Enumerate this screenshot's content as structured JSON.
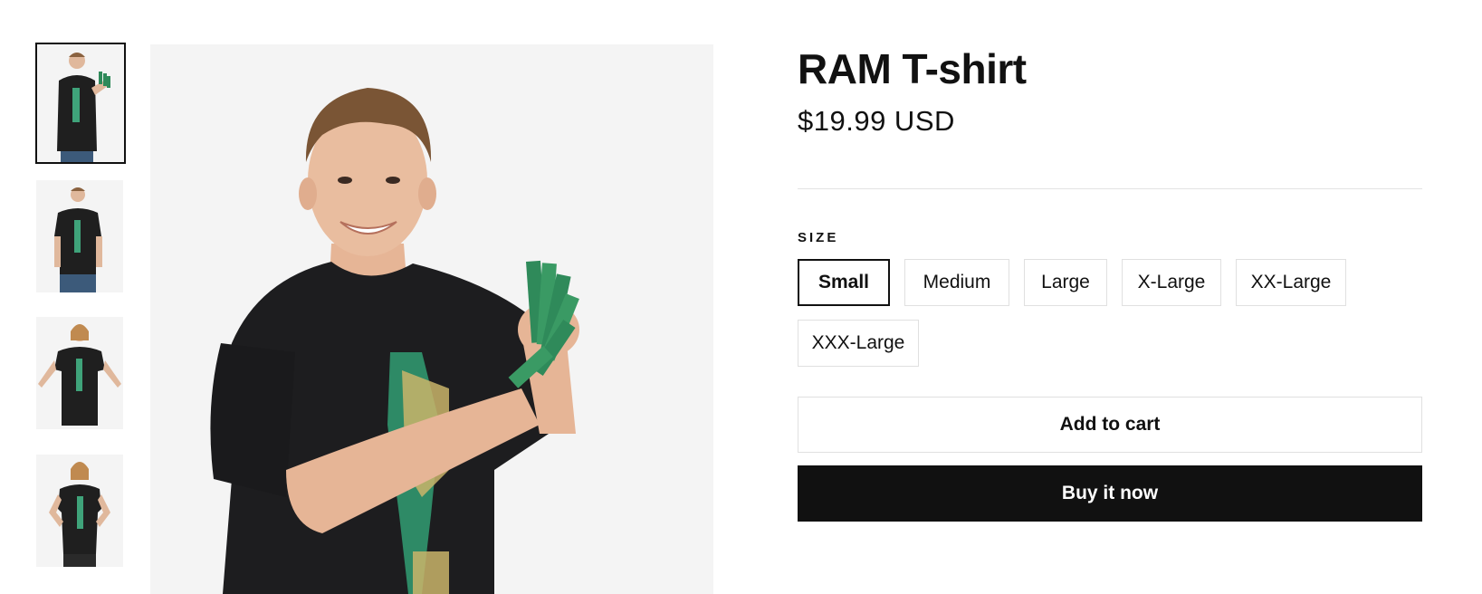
{
  "product": {
    "title": "RAM T-shirt",
    "price": "$19.99 USD"
  },
  "gallery": {
    "thumbnails": [
      {
        "name": "thumb-front-holding-ram",
        "active": true
      },
      {
        "name": "thumb-front-standing"
      },
      {
        "name": "thumb-arms-out"
      },
      {
        "name": "thumb-hands-on-hips"
      }
    ],
    "main_image": "man-in-black-ram-tshirt-holding-ram-sticks"
  },
  "options": {
    "size_label": "SIZE",
    "sizes": [
      "Small",
      "Medium",
      "Large",
      "X-Large",
      "XX-Large",
      "XXX-Large"
    ],
    "selected": "Small"
  },
  "actions": {
    "add_to_cart": "Add to cart",
    "buy_now": "Buy it now"
  },
  "colors": {
    "primary": "#111111",
    "border": "#e0e0e0",
    "image_bg": "#f4f4f4"
  }
}
